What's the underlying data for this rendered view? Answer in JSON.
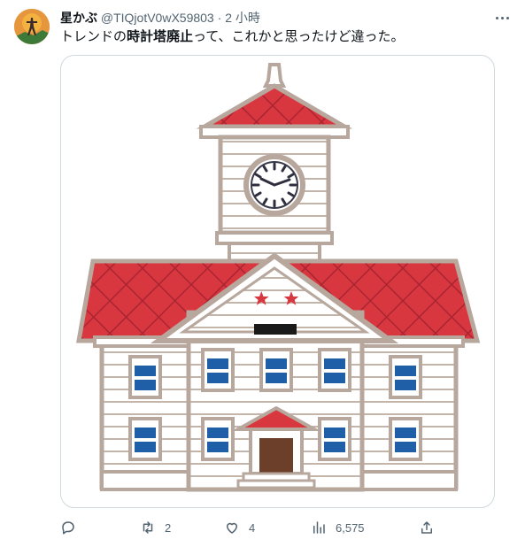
{
  "tweet": {
    "author_name": "星かぶ",
    "author_handle": "@TIQjotV0wX59803",
    "separator": "·",
    "time": "2 小時",
    "text_before": "トレンドの",
    "text_bold": "時計塔廃止",
    "text_after": "って、これかと思ったけど違った。"
  },
  "actions": {
    "reply_count": "",
    "retweet_count": "2",
    "like_count": "4",
    "views_count": "6,575"
  },
  "colors": {
    "roof": "#d9373f",
    "window": "#1f5fa8",
    "door": "#6b3f2a",
    "outline": "#b7a79d",
    "icon": "#536471"
  }
}
